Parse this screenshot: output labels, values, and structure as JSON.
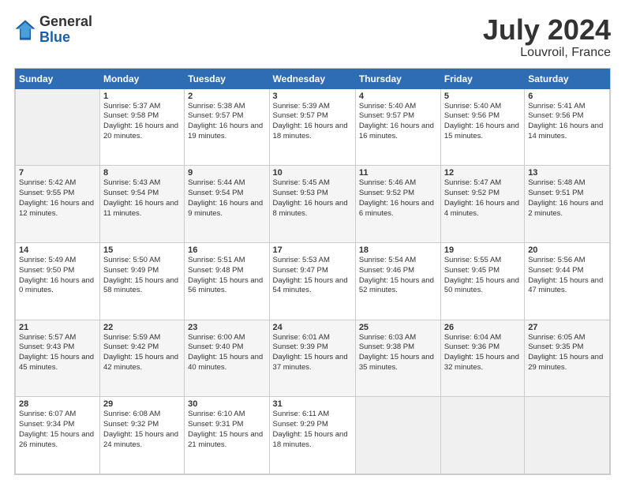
{
  "header": {
    "logo_line1": "General",
    "logo_line2": "Blue",
    "title": "July 2024",
    "location": "Louvroil, France"
  },
  "days_of_week": [
    "Sunday",
    "Monday",
    "Tuesday",
    "Wednesday",
    "Thursday",
    "Friday",
    "Saturday"
  ],
  "weeks": [
    [
      {
        "day": "",
        "sunrise": "",
        "sunset": "",
        "daylight": ""
      },
      {
        "day": "1",
        "sunrise": "Sunrise: 5:37 AM",
        "sunset": "Sunset: 9:58 PM",
        "daylight": "Daylight: 16 hours and 20 minutes."
      },
      {
        "day": "2",
        "sunrise": "Sunrise: 5:38 AM",
        "sunset": "Sunset: 9:57 PM",
        "daylight": "Daylight: 16 hours and 19 minutes."
      },
      {
        "day": "3",
        "sunrise": "Sunrise: 5:39 AM",
        "sunset": "Sunset: 9:57 PM",
        "daylight": "Daylight: 16 hours and 18 minutes."
      },
      {
        "day": "4",
        "sunrise": "Sunrise: 5:40 AM",
        "sunset": "Sunset: 9:57 PM",
        "daylight": "Daylight: 16 hours and 16 minutes."
      },
      {
        "day": "5",
        "sunrise": "Sunrise: 5:40 AM",
        "sunset": "Sunset: 9:56 PM",
        "daylight": "Daylight: 16 hours and 15 minutes."
      },
      {
        "day": "6",
        "sunrise": "Sunrise: 5:41 AM",
        "sunset": "Sunset: 9:56 PM",
        "daylight": "Daylight: 16 hours and 14 minutes."
      }
    ],
    [
      {
        "day": "7",
        "sunrise": "Sunrise: 5:42 AM",
        "sunset": "Sunset: 9:55 PM",
        "daylight": "Daylight: 16 hours and 12 minutes."
      },
      {
        "day": "8",
        "sunrise": "Sunrise: 5:43 AM",
        "sunset": "Sunset: 9:54 PM",
        "daylight": "Daylight: 16 hours and 11 minutes."
      },
      {
        "day": "9",
        "sunrise": "Sunrise: 5:44 AM",
        "sunset": "Sunset: 9:54 PM",
        "daylight": "Daylight: 16 hours and 9 minutes."
      },
      {
        "day": "10",
        "sunrise": "Sunrise: 5:45 AM",
        "sunset": "Sunset: 9:53 PM",
        "daylight": "Daylight: 16 hours and 8 minutes."
      },
      {
        "day": "11",
        "sunrise": "Sunrise: 5:46 AM",
        "sunset": "Sunset: 9:52 PM",
        "daylight": "Daylight: 16 hours and 6 minutes."
      },
      {
        "day": "12",
        "sunrise": "Sunrise: 5:47 AM",
        "sunset": "Sunset: 9:52 PM",
        "daylight": "Daylight: 16 hours and 4 minutes."
      },
      {
        "day": "13",
        "sunrise": "Sunrise: 5:48 AM",
        "sunset": "Sunset: 9:51 PM",
        "daylight": "Daylight: 16 hours and 2 minutes."
      }
    ],
    [
      {
        "day": "14",
        "sunrise": "Sunrise: 5:49 AM",
        "sunset": "Sunset: 9:50 PM",
        "daylight": "Daylight: 16 hours and 0 minutes."
      },
      {
        "day": "15",
        "sunrise": "Sunrise: 5:50 AM",
        "sunset": "Sunset: 9:49 PM",
        "daylight": "Daylight: 15 hours and 58 minutes."
      },
      {
        "day": "16",
        "sunrise": "Sunrise: 5:51 AM",
        "sunset": "Sunset: 9:48 PM",
        "daylight": "Daylight: 15 hours and 56 minutes."
      },
      {
        "day": "17",
        "sunrise": "Sunrise: 5:53 AM",
        "sunset": "Sunset: 9:47 PM",
        "daylight": "Daylight: 15 hours and 54 minutes."
      },
      {
        "day": "18",
        "sunrise": "Sunrise: 5:54 AM",
        "sunset": "Sunset: 9:46 PM",
        "daylight": "Daylight: 15 hours and 52 minutes."
      },
      {
        "day": "19",
        "sunrise": "Sunrise: 5:55 AM",
        "sunset": "Sunset: 9:45 PM",
        "daylight": "Daylight: 15 hours and 50 minutes."
      },
      {
        "day": "20",
        "sunrise": "Sunrise: 5:56 AM",
        "sunset": "Sunset: 9:44 PM",
        "daylight": "Daylight: 15 hours and 47 minutes."
      }
    ],
    [
      {
        "day": "21",
        "sunrise": "Sunrise: 5:57 AM",
        "sunset": "Sunset: 9:43 PM",
        "daylight": "Daylight: 15 hours and 45 minutes."
      },
      {
        "day": "22",
        "sunrise": "Sunrise: 5:59 AM",
        "sunset": "Sunset: 9:42 PM",
        "daylight": "Daylight: 15 hours and 42 minutes."
      },
      {
        "day": "23",
        "sunrise": "Sunrise: 6:00 AM",
        "sunset": "Sunset: 9:40 PM",
        "daylight": "Daylight: 15 hours and 40 minutes."
      },
      {
        "day": "24",
        "sunrise": "Sunrise: 6:01 AM",
        "sunset": "Sunset: 9:39 PM",
        "daylight": "Daylight: 15 hours and 37 minutes."
      },
      {
        "day": "25",
        "sunrise": "Sunrise: 6:03 AM",
        "sunset": "Sunset: 9:38 PM",
        "daylight": "Daylight: 15 hours and 35 minutes."
      },
      {
        "day": "26",
        "sunrise": "Sunrise: 6:04 AM",
        "sunset": "Sunset: 9:36 PM",
        "daylight": "Daylight: 15 hours and 32 minutes."
      },
      {
        "day": "27",
        "sunrise": "Sunrise: 6:05 AM",
        "sunset": "Sunset: 9:35 PM",
        "daylight": "Daylight: 15 hours and 29 minutes."
      }
    ],
    [
      {
        "day": "28",
        "sunrise": "Sunrise: 6:07 AM",
        "sunset": "Sunset: 9:34 PM",
        "daylight": "Daylight: 15 hours and 26 minutes."
      },
      {
        "day": "29",
        "sunrise": "Sunrise: 6:08 AM",
        "sunset": "Sunset: 9:32 PM",
        "daylight": "Daylight: 15 hours and 24 minutes."
      },
      {
        "day": "30",
        "sunrise": "Sunrise: 6:10 AM",
        "sunset": "Sunset: 9:31 PM",
        "daylight": "Daylight: 15 hours and 21 minutes."
      },
      {
        "day": "31",
        "sunrise": "Sunrise: 6:11 AM",
        "sunset": "Sunset: 9:29 PM",
        "daylight": "Daylight: 15 hours and 18 minutes."
      },
      {
        "day": "",
        "sunrise": "",
        "sunset": "",
        "daylight": ""
      },
      {
        "day": "",
        "sunrise": "",
        "sunset": "",
        "daylight": ""
      },
      {
        "day": "",
        "sunrise": "",
        "sunset": "",
        "daylight": ""
      }
    ]
  ]
}
